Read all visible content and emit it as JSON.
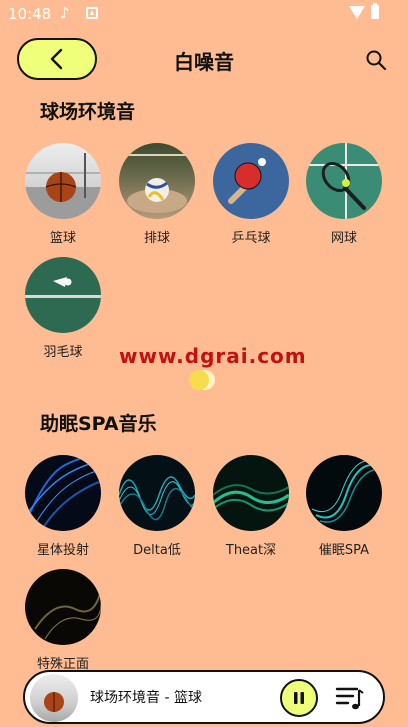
{
  "status_bar": {
    "time": "10:48"
  },
  "header": {
    "title": "白噪音"
  },
  "sections": [
    {
      "title": "球场环境音",
      "items": [
        {
          "label": "篮球",
          "icon": "basketball-icon"
        },
        {
          "label": "排球",
          "icon": "volleyball-icon"
        },
        {
          "label": "乒乓球",
          "icon": "ping-pong-icon"
        },
        {
          "label": "网球",
          "icon": "tennis-icon"
        },
        {
          "label": "羽毛球",
          "icon": "badminton-icon"
        }
      ]
    },
    {
      "title": "助眠SPA音乐",
      "items": [
        {
          "label": "星体投射",
          "icon": "wave-icon"
        },
        {
          "label": "Delta低",
          "icon": "wave-icon"
        },
        {
          "label": "Theat深",
          "icon": "wave-icon"
        },
        {
          "label": "催眠SPA",
          "icon": "wave-icon"
        },
        {
          "label": "特殊正面",
          "icon": "wave-icon"
        }
      ]
    }
  ],
  "watermark": "www.dgrai.com",
  "player": {
    "now_playing": "球场环境音 - 篮球"
  },
  "colors": {
    "background": "#FFBC92",
    "accent": "#EFFF7A"
  }
}
